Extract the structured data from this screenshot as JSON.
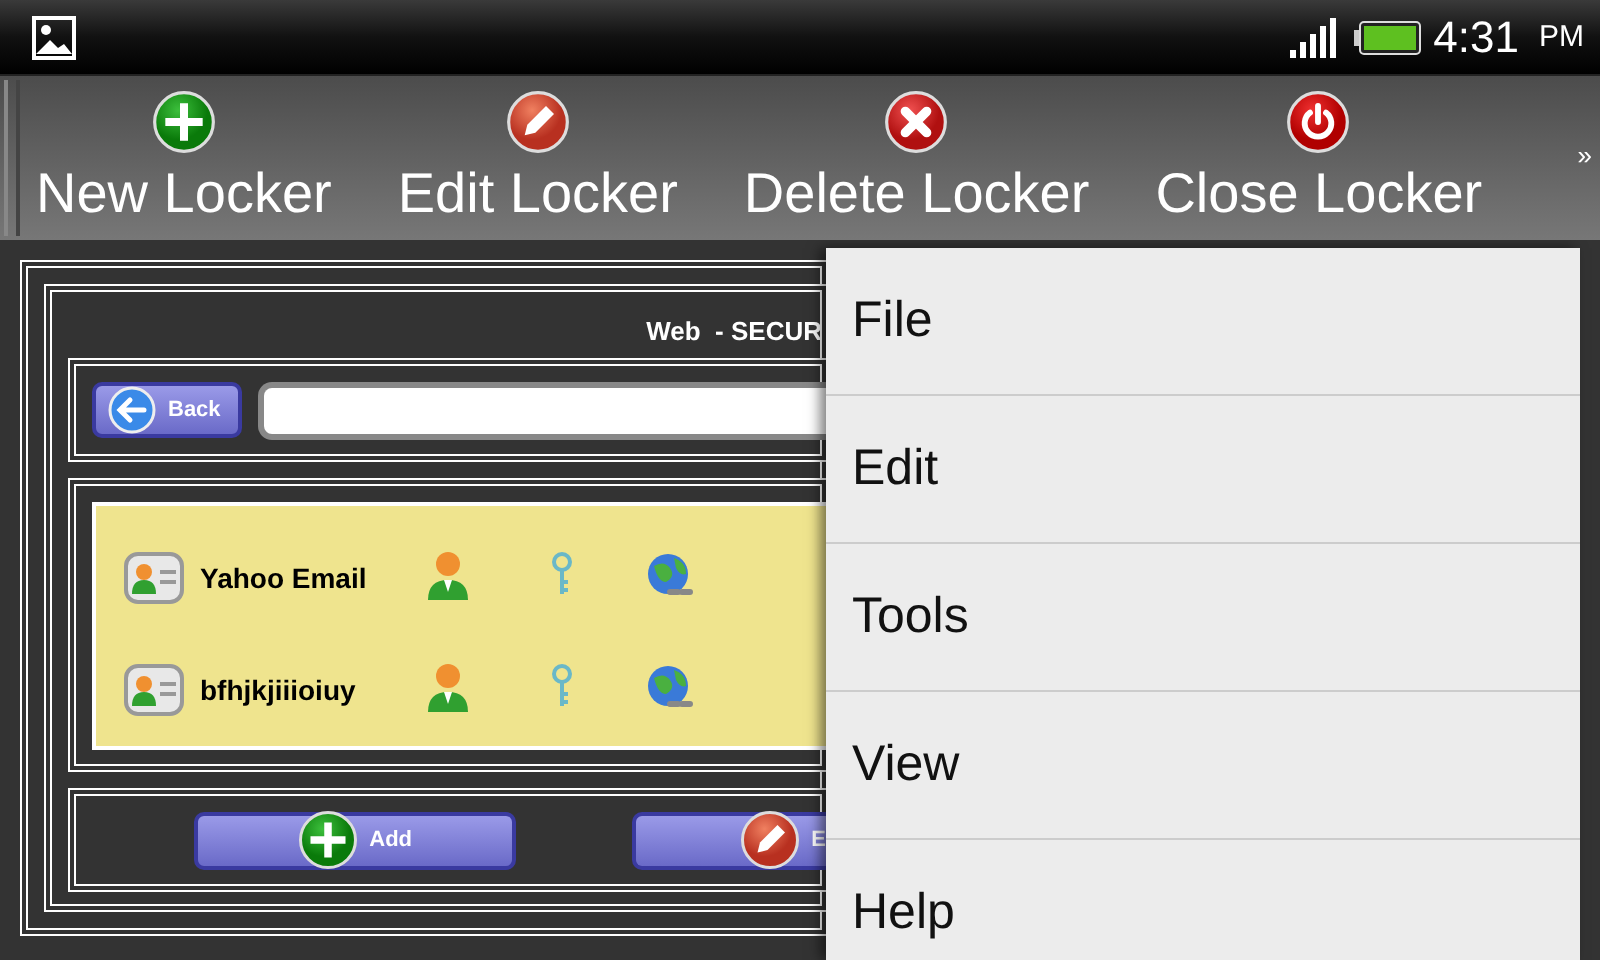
{
  "status_bar": {
    "time": "4:31",
    "ampm": "PM"
  },
  "action_bar": {
    "actions": [
      {
        "label": "New Locker",
        "kind": "add"
      },
      {
        "label": "Edit Locker",
        "kind": "edit"
      },
      {
        "label": "Delete Locker",
        "kind": "delete"
      },
      {
        "label": "Close Locker",
        "kind": "close"
      }
    ],
    "overflow": "»"
  },
  "locker": {
    "title": "Web  - SECUR",
    "back_button": "Back",
    "entries": [
      {
        "name": "Yahoo Email"
      },
      {
        "name": "bfhjkjiiioiuy"
      }
    ],
    "buttons": [
      {
        "label": "Add",
        "kind": "add"
      },
      {
        "label": "E",
        "kind": "edit"
      }
    ]
  },
  "menu": {
    "items": [
      "File",
      "Edit",
      "Tools",
      "View",
      "Help"
    ]
  }
}
